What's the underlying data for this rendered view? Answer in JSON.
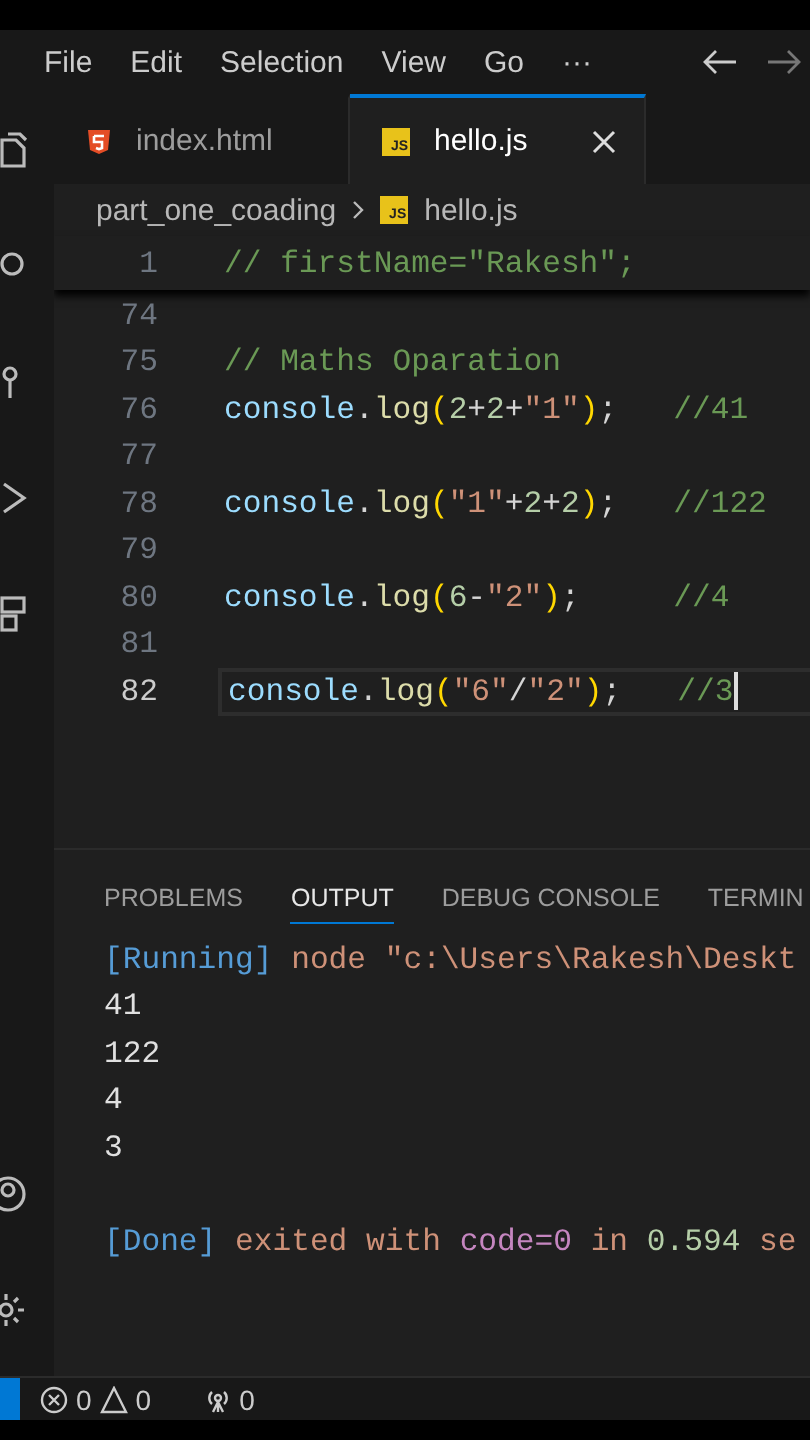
{
  "menu": [
    {
      "label": "File"
    },
    {
      "label": "Edit"
    },
    {
      "label": "Selection"
    },
    {
      "label": "View"
    },
    {
      "label": "Go"
    },
    {
      "label": "···"
    }
  ],
  "nav": [
    {
      "kind": "back",
      "disabled": false
    },
    {
      "kind": "forward",
      "disabled": true
    }
  ],
  "tabs": [
    {
      "label": "index.html",
      "kind": "html",
      "selected": false
    },
    {
      "label": "hello.js",
      "kind": "js",
      "badge": "JS",
      "selected": true
    }
  ],
  "breadcrumb": {
    "folder": "part_one_coading",
    "file": "hello.js",
    "badge": "JS"
  },
  "sticky_line": {
    "number": "1",
    "tokens": [
      {
        "kind": "comment",
        "text": "// firstName=\"Rakesh\";"
      }
    ]
  },
  "lines": [
    {
      "number": "74",
      "current": false
    },
    {
      "number": "75",
      "current": false,
      "tokens": [
        {
          "kind": "comment",
          "text": "// Maths Oparation"
        }
      ]
    },
    {
      "number": "76",
      "current": false,
      "tokens": [
        {
          "kind": "ident",
          "text": "console"
        },
        {
          "kind": "punct",
          "text": "."
        },
        {
          "kind": "fn",
          "text": "log"
        },
        {
          "kind": "paren",
          "text": "("
        },
        {
          "kind": "num",
          "text": "2"
        },
        {
          "kind": "punct",
          "text": "+"
        },
        {
          "kind": "num",
          "text": "2"
        },
        {
          "kind": "punct",
          "text": "+"
        },
        {
          "kind": "str",
          "text": "\"1\""
        },
        {
          "kind": "paren",
          "text": ")"
        },
        {
          "kind": "punct",
          "text": ";   "
        },
        {
          "kind": "comment",
          "text": "//41"
        }
      ]
    },
    {
      "number": "77",
      "current": false
    },
    {
      "number": "78",
      "current": false,
      "tokens": [
        {
          "kind": "ident",
          "text": "console"
        },
        {
          "kind": "punct",
          "text": "."
        },
        {
          "kind": "fn",
          "text": "log"
        },
        {
          "kind": "paren",
          "text": "("
        },
        {
          "kind": "str",
          "text": "\"1\""
        },
        {
          "kind": "punct",
          "text": "+"
        },
        {
          "kind": "num",
          "text": "2"
        },
        {
          "kind": "punct",
          "text": "+"
        },
        {
          "kind": "num",
          "text": "2"
        },
        {
          "kind": "paren",
          "text": ")"
        },
        {
          "kind": "punct",
          "text": ";   "
        },
        {
          "kind": "comment",
          "text": "//122"
        }
      ]
    },
    {
      "number": "79",
      "current": false
    },
    {
      "number": "80",
      "current": false,
      "tokens": [
        {
          "kind": "ident",
          "text": "console"
        },
        {
          "kind": "punct",
          "text": "."
        },
        {
          "kind": "fn",
          "text": "log"
        },
        {
          "kind": "paren",
          "text": "("
        },
        {
          "kind": "num",
          "text": "6"
        },
        {
          "kind": "punct",
          "text": "-"
        },
        {
          "kind": "str",
          "text": "\"2\""
        },
        {
          "kind": "paren",
          "text": ")"
        },
        {
          "kind": "punct",
          "text": ";     "
        },
        {
          "kind": "comment",
          "text": "//4"
        }
      ]
    },
    {
      "number": "81",
      "current": false
    },
    {
      "number": "82",
      "current": true,
      "tokens": [
        {
          "kind": "ident",
          "text": "console"
        },
        {
          "kind": "punct",
          "text": "."
        },
        {
          "kind": "fn",
          "text": "log"
        },
        {
          "kind": "paren",
          "text": "("
        },
        {
          "kind": "str",
          "text": "\"6\""
        },
        {
          "kind": "punct",
          "text": "/"
        },
        {
          "kind": "str",
          "text": "\"2\""
        },
        {
          "kind": "paren",
          "text": ")"
        },
        {
          "kind": "punct",
          "text": ";   "
        },
        {
          "kind": "comment",
          "text": "//3"
        }
      ]
    }
  ],
  "panel": {
    "tabs": [
      {
        "label": "PROBLEMS",
        "selected": false
      },
      {
        "label": "OUTPUT",
        "selected": true
      },
      {
        "label": "DEBUG CONSOLE",
        "selected": false
      },
      {
        "label": "TERMIN",
        "selected": false
      }
    ],
    "output": [
      {
        "tokens": [
          {
            "kind": "tag",
            "text": "[Running]"
          },
          {
            "kind": "text",
            "text": " node \"c:\\Users\\Rakesh\\Deskt"
          }
        ]
      },
      {
        "tokens": [
          {
            "kind": "plain",
            "text": "41"
          }
        ]
      },
      {
        "tokens": [
          {
            "kind": "plain",
            "text": "122"
          }
        ]
      },
      {
        "tokens": [
          {
            "kind": "plain",
            "text": "4"
          }
        ]
      },
      {
        "tokens": [
          {
            "kind": "plain",
            "text": "3"
          }
        ]
      },
      {
        "spaced": true,
        "tokens": [
          {
            "kind": "tag",
            "text": "[Done]"
          },
          {
            "kind": "text",
            "text": " exited with "
          },
          {
            "kind": "code",
            "text": "code=0"
          },
          {
            "kind": "text",
            "text": " in "
          },
          {
            "kind": "num",
            "text": "0.594"
          },
          {
            "kind": "text",
            "text": " se"
          }
        ]
      }
    ]
  },
  "status_bar": {
    "errors": "0",
    "warnings": "0",
    "ports": "0"
  }
}
